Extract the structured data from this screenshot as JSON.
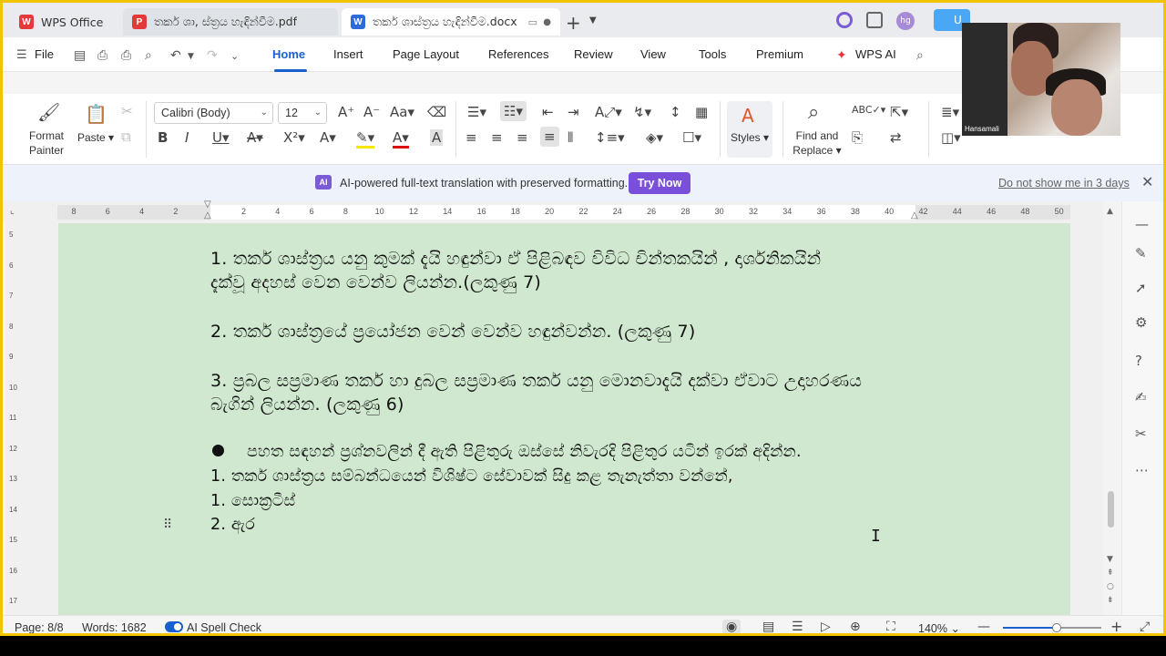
{
  "tabs": [
    {
      "label": "WPS Office",
      "icon": "wps-icon"
    },
    {
      "label": "තර්ක ශා, ස්ත්‍රය හැඳින්වීම.pdf",
      "icon": "pdf-icon"
    },
    {
      "label": "තර්ක ශාස්ත්‍රය හැඳින්වීම.docx",
      "icon": "word-icon"
    }
  ],
  "account": {
    "initials": "hg",
    "button_label": "U"
  },
  "menu": {
    "file": "File",
    "items": [
      "Home",
      "Insert",
      "Page Layout",
      "References",
      "Review",
      "View",
      "Tools",
      "Premium"
    ],
    "wps_ai": "WPS AI",
    "active": "Home"
  },
  "ribbon": {
    "format_painter": [
      "Format",
      "Painter"
    ],
    "paste": "Paste",
    "font_name": "Calibri (Body)",
    "font_size": "12",
    "styles": "Styles",
    "find_replace": [
      "Find and",
      "Replace"
    ]
  },
  "banner": {
    "text": "AI-powered full-text translation with preserved formatting.",
    "button": "Try Now",
    "dismiss": "Do not show me in 3 days",
    "badge": "AI"
  },
  "ruler": {
    "numbers": [
      "8",
      "6",
      "4",
      "2",
      "2",
      "4",
      "6",
      "8",
      "10",
      "12",
      "14",
      "16",
      "18",
      "20",
      "22",
      "24",
      "26",
      "28",
      "30",
      "32",
      "34",
      "36",
      "38",
      "40",
      "42",
      "44",
      "46",
      "48",
      "50"
    ]
  },
  "vruler": [
    "5",
    "6",
    "7",
    "8",
    "9",
    "10",
    "11",
    "12",
    "13",
    "14",
    "15",
    "16",
    "17"
  ],
  "document": {
    "lines": [
      "1. තර්ක  ශාස්ත්‍රය  යනු  කුමක්  දැයි  හඳුන්වා  ඒ  පිළිබඳව  විවිධ  චින්තකයින් , දාර්ශනිකයින්",
      "දැක්වූ  අදහස් වෙන වෙන්ව  ලියන්න.(ලකුණු  7)",
      "2. තර්ක  ශාස්ත්‍රයේ  ප්‍රයෝජන  වෙන්  වෙන්ව  හඳුන්වන්න. (ලකුණු 7)",
      "3. ප්‍රබල සප්‍රමාණ තර්ක හා දුබල සප්‍රමාණ තර්ක යනු මොනවාදැයි දක්වා ඒවාට උදාහරණය",
      "බැගින් ලියන්න.  (ලකුණු 6)",
      "පහත සඳහන් ප්‍රශ්නවලින් දී ඇති පිළිතුරු ඔස්සේ නිවැරදි පිළිතුර යටින් ඉරක් අදින්න.",
      "1. තර්ක ශාස්ත්‍රය සම්බන්ධයෙන් විශිෂ්ට සේවාවක් සිදු කළ තැනැත්තා වන්නේ,",
      "1. සොක්‍රටීස්",
      "2. ඇර"
    ]
  },
  "status": {
    "page": "Page: 8/8",
    "words": "Words: 1682",
    "spell": "AI Spell Check",
    "zoom": "140%",
    "zoom_fraction": 0.55
  },
  "video": {
    "name": "Hansamali"
  },
  "colors": {
    "accent": "#1a5fd0",
    "page_bg": "#cfe8cf",
    "frame": "#f0c400",
    "try_now": "#7a4fd9"
  }
}
